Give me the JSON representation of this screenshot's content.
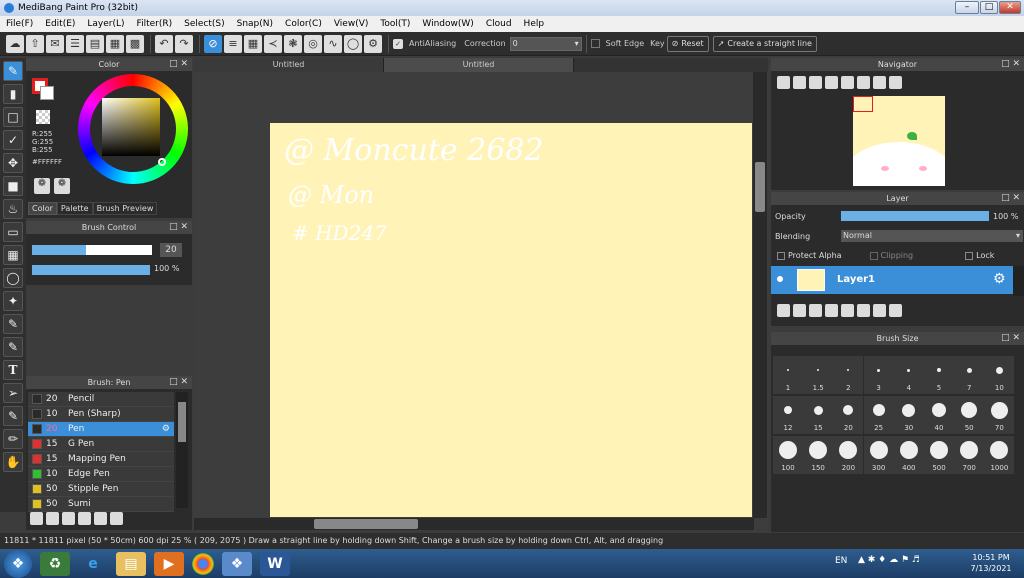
{
  "window": {
    "title": "MediBang Paint Pro (32bit)"
  },
  "menu": [
    "File(F)",
    "Edit(E)",
    "Layer(L)",
    "Filter(R)",
    "Select(S)",
    "Snap(N)",
    "Color(C)",
    "View(V)",
    "Tool(T)",
    "Window(W)",
    "Cloud",
    "Help"
  ],
  "toolbar": {
    "antialiasing": "AntiAliasing",
    "correction_label": "Correction",
    "correction_value": "0",
    "soft_edge": "Soft Edge",
    "key_label": "Key",
    "reset": "Reset",
    "straight_line": "Create a straight line"
  },
  "color_panel": {
    "title": "Color",
    "r": "R:255",
    "g": "G:255",
    "b": "B:255",
    "hex": "#FFFFFF",
    "tabs": [
      "Color",
      "Palette",
      "Brush Preview"
    ],
    "fg_color": "#ffffff",
    "bg_color": "#e02020"
  },
  "brush_control": {
    "title": "Brush Control",
    "size": "20",
    "opacity": "100 %",
    "size_level": 0.45,
    "opacity_level": 1.0
  },
  "brush_list": {
    "title": "Brush: Pen",
    "items": [
      {
        "size": "20",
        "name": "Pencil",
        "color": "#2a2a2a"
      },
      {
        "size": "10",
        "name": "Pen (Sharp)",
        "color": "#2a2a2a"
      },
      {
        "size": "20",
        "name": "Pen",
        "color": "#2a2a2a",
        "selected": true
      },
      {
        "size": "15",
        "name": "G Pen",
        "color": "#e03030"
      },
      {
        "size": "15",
        "name": "Mapping Pen",
        "color": "#e03030"
      },
      {
        "size": "10",
        "name": "Edge Pen",
        "color": "#30c030"
      },
      {
        "size": "50",
        "name": "Stipple Pen",
        "color": "#e0c020"
      },
      {
        "size": "50",
        "name": "Sumi",
        "color": "#e0c020"
      }
    ]
  },
  "tabs": [
    "Untitled",
    "Untitled"
  ],
  "canvas": {
    "lines": [
      "@ Moncute 2682",
      "@ Mon",
      "# HD247"
    ],
    "paper_color": "#fff3b8"
  },
  "statusbar": {
    "text": "11811 * 11811 pixel   (50 * 50cm)   600 dpi   25 %   ( 209, 2075 )   Draw a straight line by holding down Shift, Change a brush size by holding down Ctrl, Alt, and dragging"
  },
  "navigator": {
    "title": "Navigator"
  },
  "layer": {
    "title": "Layer",
    "opacity_label": "Opacity",
    "opacity_value": "100 %",
    "blending_label": "Blending",
    "blending_value": "Normal",
    "protect_alpha": "Protect Alpha",
    "clipping": "Clipping",
    "lock": "Lock",
    "layer_name": "Layer1"
  },
  "brush_size": {
    "title": "Brush Size",
    "sizes": [
      "1",
      "1.5",
      "2",
      "3",
      "4",
      "5",
      "7",
      "10",
      "12",
      "15",
      "20",
      "25",
      "30",
      "40",
      "50",
      "70",
      "100",
      "150",
      "200",
      "300",
      "400",
      "500",
      "700",
      "1000"
    ]
  },
  "tray": {
    "lang": "EN",
    "time": "10:51 PM",
    "date": "7/13/2021"
  }
}
